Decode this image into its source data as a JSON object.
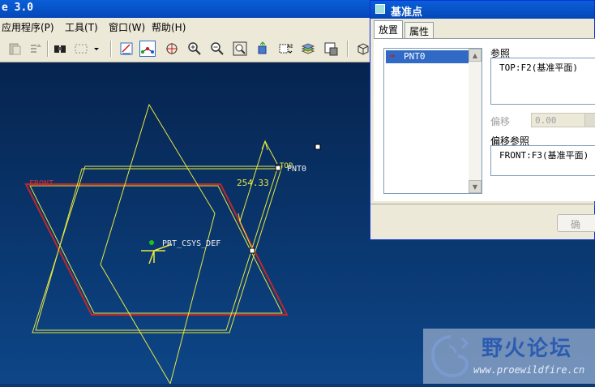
{
  "window": {
    "title": "e 3.0"
  },
  "menu": {
    "items": [
      "应用程序(P)",
      "工具(T)",
      "窗口(W)",
      "帮助(H)"
    ]
  },
  "toolbar": {
    "icons": [
      "paste-icon",
      "regenerate-icon",
      "find-icon",
      "select-box-icon",
      "dropdown-icon",
      "datum-display-icon",
      "datum-point-icon",
      "spin-center-icon",
      "zoom-in-icon",
      "zoom-out-icon",
      "zoom-fit-icon",
      "orient-icon",
      "saved-views-icon",
      "layers-icon",
      "view-manager-icon",
      "cube-icon"
    ]
  },
  "viewport": {
    "labels": {
      "front": "FRONT",
      "top": "TOP",
      "point": "PNT0",
      "dimension": "254.33",
      "csys": "PRT_CSYS_DEF"
    },
    "colors": {
      "background_top": "#06244f",
      "background_bottom": "#0d4688",
      "plane_front": "#c0282a",
      "plane_yellow": "#e8e840"
    }
  },
  "dialog": {
    "title": "基准点",
    "tabs": [
      {
        "label": "放置",
        "active": true
      },
      {
        "label": "属性",
        "active": false
      }
    ],
    "list": {
      "items": [
        {
          "label": "PNT0",
          "selected": true
        }
      ]
    },
    "references": {
      "label": "参照",
      "value": "TOP:F2(基准平面)"
    },
    "offset": {
      "label": "偏移",
      "value": "0.00"
    },
    "offset_references": {
      "label": "偏移参照",
      "value": "FRONT:F3(基准平面)"
    },
    "ok_button": "确"
  },
  "watermark": {
    "title": "野火论坛",
    "url": "www.proewildfire.cn"
  }
}
